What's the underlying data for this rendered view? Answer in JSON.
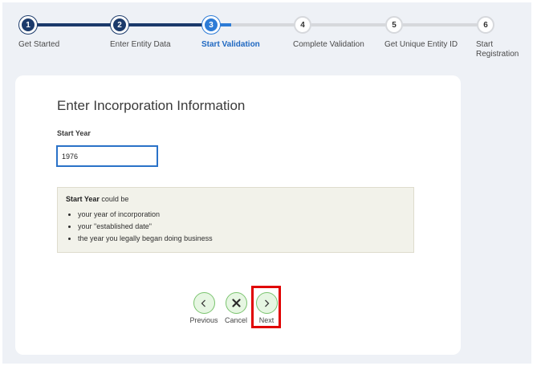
{
  "stepper": {
    "steps": [
      {
        "number": "1",
        "label": "Get Started",
        "state": "done"
      },
      {
        "number": "2",
        "label": "Enter Entity Data",
        "state": "done"
      },
      {
        "number": "3",
        "label": "Start Validation",
        "state": "current"
      },
      {
        "number": "4",
        "label": "Complete Validation",
        "state": "todo"
      },
      {
        "number": "5",
        "label": "Get Unique Entity ID",
        "state": "todo"
      },
      {
        "number": "6",
        "label_line1": "Start",
        "label_line2": "Registration",
        "state": "todo"
      }
    ]
  },
  "form": {
    "title": "Enter Incorporation Information",
    "field_label": "Start Year",
    "start_year_value": "1976"
  },
  "info": {
    "lead_bold": "Start Year",
    "lead_rest": " could be",
    "bullets": [
      "your year of incorporation",
      "your \"established date\"",
      "the year you legally began doing business"
    ]
  },
  "nav": {
    "previous_label": "Previous",
    "cancel_label": "Cancel",
    "next_label": "Next"
  },
  "colors": {
    "step_done": "#1b3a6b",
    "step_current": "#2c7bd6",
    "button_fill": "#e6f6e2",
    "button_border": "#7bc46f",
    "highlight": "#e00000"
  }
}
